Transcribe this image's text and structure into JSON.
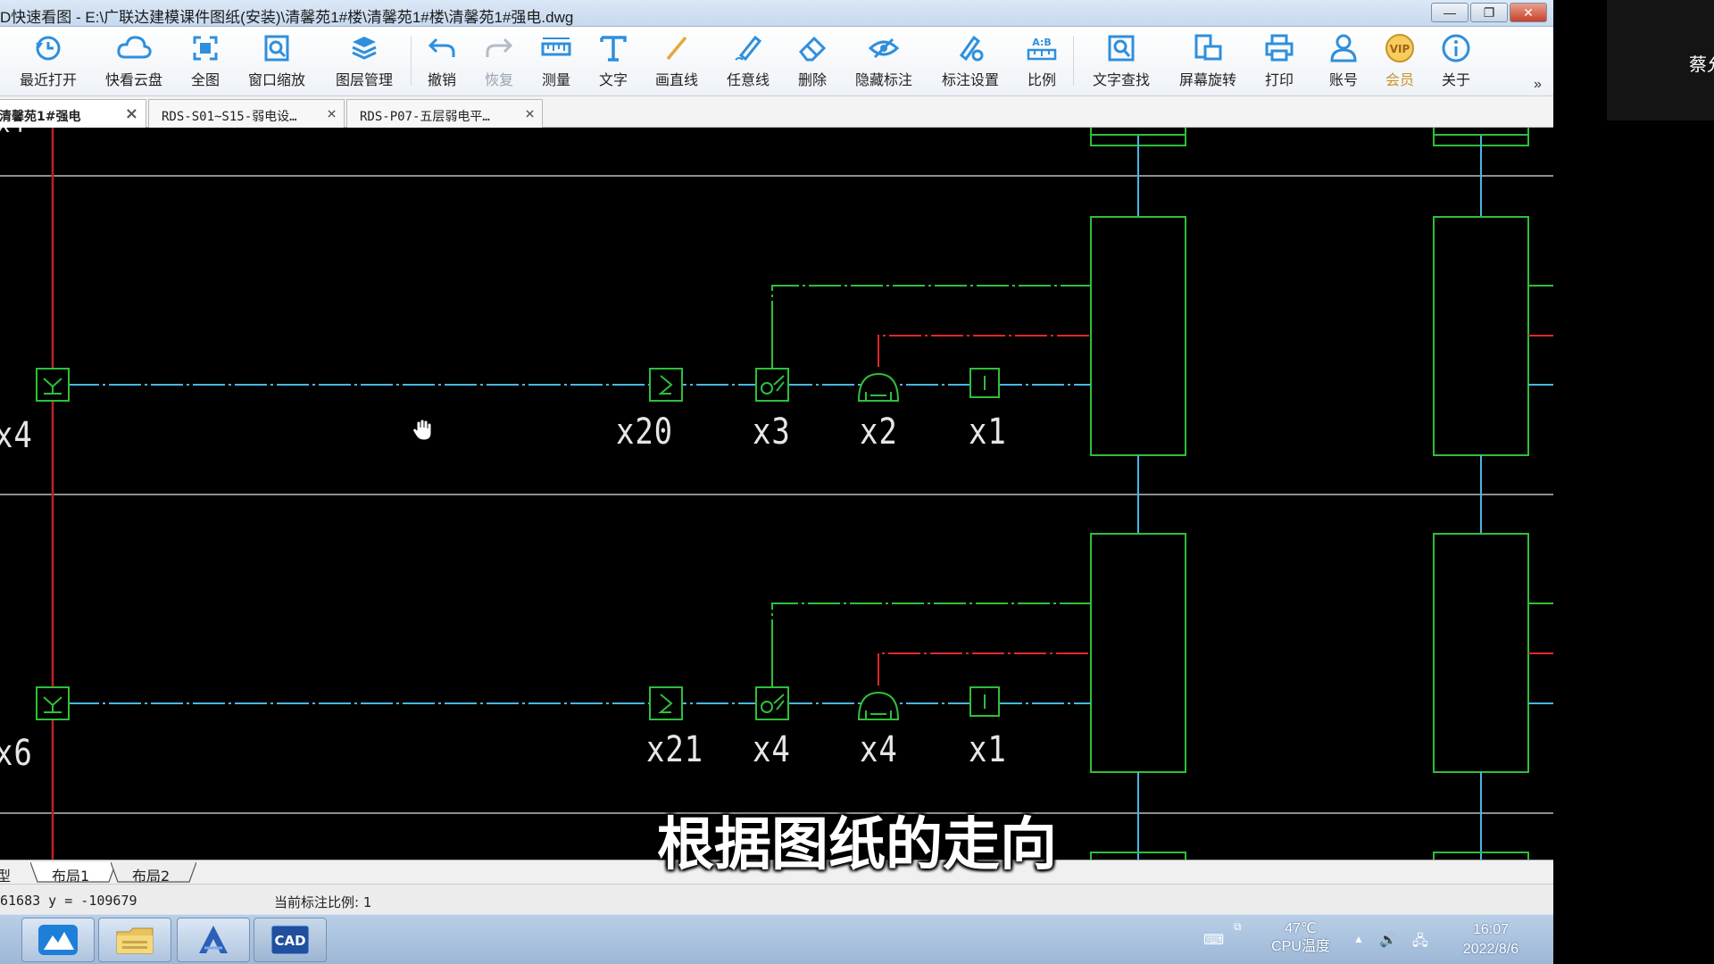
{
  "window": {
    "title": "D快速看图 - E:\\广联达建模课件图纸(安装)\\清馨苑1#楼\\清馨苑1#楼\\清馨苑1#强电.dwg",
    "min_symbol": "—",
    "restore_symbol": "❐",
    "close_symbol": "✕"
  },
  "toolbar": {
    "items": [
      {
        "label": "最近打开",
        "icon": "clock-icon"
      },
      {
        "label": "快看云盘",
        "icon": "cloud-icon"
      },
      {
        "label": "全图",
        "icon": "fullview-icon"
      },
      {
        "label": "窗口缩放",
        "icon": "window-zoom-icon"
      },
      {
        "label": "图层管理",
        "icon": "layers-icon"
      },
      {
        "label": "撤销",
        "icon": "undo-icon"
      },
      {
        "label": "恢复",
        "icon": "redo-icon"
      },
      {
        "label": "测量",
        "icon": "ruler-icon"
      },
      {
        "label": "文字",
        "icon": "text-icon"
      },
      {
        "label": "画直线",
        "icon": "line-icon"
      },
      {
        "label": "任意线",
        "icon": "pen-icon"
      },
      {
        "label": "删除",
        "icon": "eraser-icon"
      },
      {
        "label": "隐藏标注",
        "icon": "eye-hide-icon"
      },
      {
        "label": "标注设置",
        "icon": "annotation-settings-icon"
      },
      {
        "label": "比例",
        "icon": "scale-icon"
      },
      {
        "label": "文字查找",
        "icon": "text-search-icon"
      },
      {
        "label": "屏幕旋转",
        "icon": "rotate-screen-icon"
      },
      {
        "label": "打印",
        "icon": "printer-icon"
      },
      {
        "label": "账号",
        "icon": "user-icon"
      },
      {
        "label": "会员",
        "icon": "vip-icon"
      },
      {
        "label": "关于",
        "icon": "info-icon"
      }
    ],
    "more": "»"
  },
  "file_tabs": [
    {
      "label": "清馨苑1#强电",
      "active": true
    },
    {
      "label": "RDS-S01~S15-弱电设…",
      "active": false
    },
    {
      "label": "RDS-P07-五层弱电平…",
      "active": false
    }
  ],
  "tab_close_symbol": "×",
  "drawing": {
    "row1": {
      "left_label": "x4",
      "multipliers": [
        "x20",
        "x3",
        "x2",
        "x1"
      ]
    },
    "row2": {
      "left_label": "x6",
      "multipliers": [
        "x21",
        "x4",
        "x4",
        "x1"
      ]
    },
    "top_fragment": "x4",
    "colors": {
      "green": "#2fbf3a",
      "cyan": "#49b7e6",
      "red": "#e0282a",
      "white_line": "#cfcfcf"
    }
  },
  "caption": "根据图纸的走向",
  "layout_tabs": [
    "型",
    "布局1",
    "布局2"
  ],
  "status": {
    "coords": "61683 y = -109679",
    "scale": "当前标注比例: 1"
  },
  "taskbar": {
    "apps": [
      "app-mountain-icon",
      "file-explorer-icon",
      "glodon-a-icon",
      "cad-app-icon"
    ],
    "cad_label": "CAD",
    "temp": "47℃",
    "temp_label": "CPU温度",
    "time": "16:07",
    "date": "2022/8/6"
  },
  "side_panel": {
    "name": "蔡允"
  }
}
